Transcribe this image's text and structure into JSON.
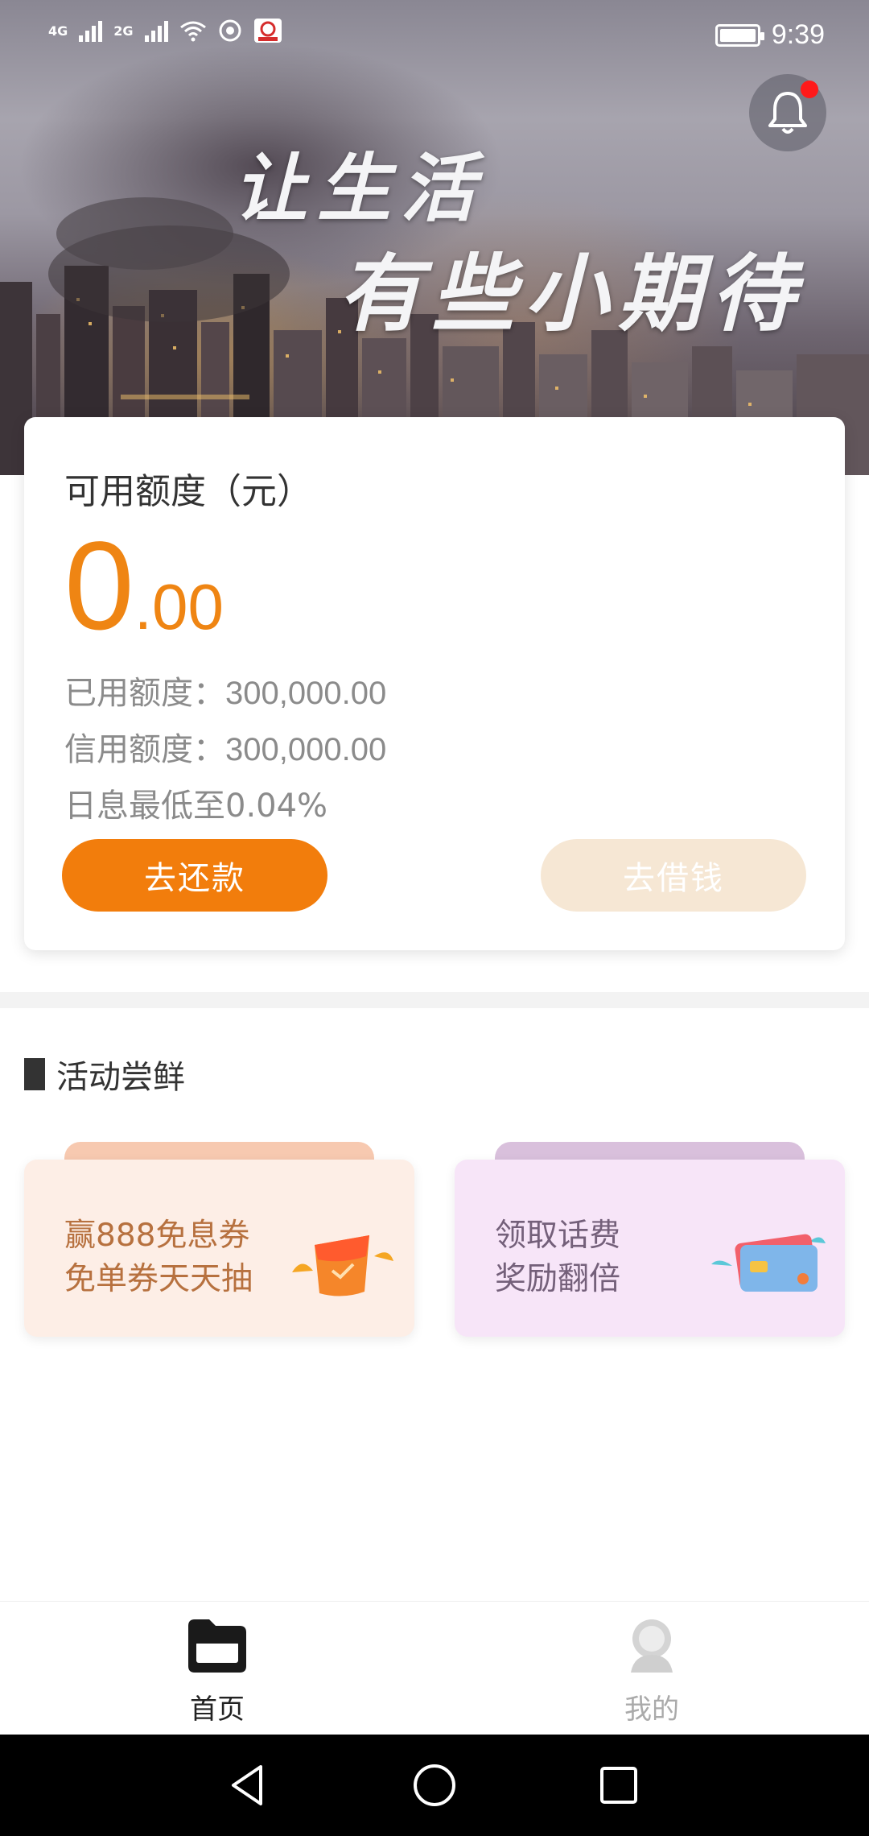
{
  "status_bar": {
    "network_1": "4G",
    "network_2": "2G",
    "time": "9:39"
  },
  "hero": {
    "slogan_line1": "让生活",
    "slogan_line2": "有些小期待",
    "notification_unread": true
  },
  "credit": {
    "title": "可用额度（元）",
    "available_int": "0",
    "available_dec": ".00",
    "used_label": "已用额度：",
    "used_value": "300,000.00",
    "credit_label": "信用额度：",
    "credit_value": "300,000.00",
    "rate_text": "日息最低至0.04%",
    "repay_button": "去还款",
    "borrow_button": "去借钱"
  },
  "activities": {
    "title": "活动尝鲜",
    "cards": [
      {
        "line1": "赢888免息券",
        "line2": "免单券天天抽"
      },
      {
        "line1": "领取话费",
        "line2": "奖励翻倍"
      }
    ]
  },
  "bottom_nav": {
    "items": [
      {
        "label": "首页",
        "icon": "home-folder-icon",
        "active": true
      },
      {
        "label": "我的",
        "icon": "profile-icon",
        "active": false
      }
    ]
  },
  "colors": {
    "accent": "#f27d0c",
    "amount": "#ef8513",
    "borrow_disabled": "#f6e7d4"
  }
}
